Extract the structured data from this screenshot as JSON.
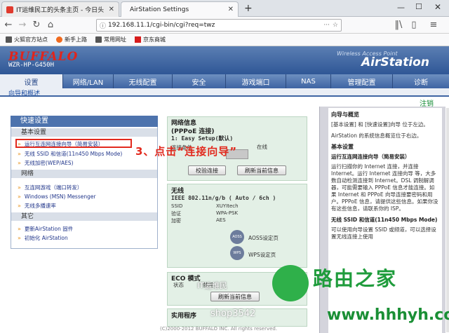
{
  "browser": {
    "tabs": [
      {
        "title": "IT运维民工的头条主页 - 今日头"
      },
      {
        "title": "AirStation Settings"
      }
    ],
    "url": "192.168.11.1/cgi-bin/cgi?req=twz",
    "bookmarks": [
      "火狐官方站点",
      "新手上路",
      "常用网址",
      "京东商城"
    ]
  },
  "header": {
    "logo": "BUFFALO",
    "model": "WZR-HP-G450H",
    "tagline": "Wireless Access Point",
    "product": "AirStation"
  },
  "nav": {
    "items": [
      "设置",
      "网络/LAN",
      "无线配置",
      "安全",
      "游戏端口",
      "NAS",
      "管理配置",
      "诊断"
    ],
    "sub": "向导和概述",
    "logout": "注销"
  },
  "quick": {
    "title": "快速设置",
    "basic_label": "基本设置",
    "basic_items": [
      "运行互连网连接向导（简易安装）",
      "无线 SSID 和信道(11n450 Mbps Mode)",
      "无线加密(WEP/AES)"
    ],
    "net_label": "网络",
    "net_items": [
      "互连网游戏（端口转发）",
      "Windows (MSN) Messenger",
      "无线多播速率"
    ],
    "other_label": "其它",
    "other_items": [
      "更新AirStation 固件",
      "初始化 AirStation"
    ]
  },
  "annotation": "3、点击“连接向导”",
  "netinfo": {
    "title": "网络信息",
    "sub": "(PPPoE 连接)",
    "line": "1: Easy  Setup(默认)",
    "conn_label": "连接条件",
    "conn_value": "在线",
    "btn_connect": "校验连接",
    "btn_refresh": "刷新当前信息"
  },
  "wireless": {
    "title": "无线",
    "mode": "IEEE 802.11n/g/b ( Auto / 6ch )",
    "rows": [
      {
        "k": "SSID",
        "v": "XUYItech"
      },
      {
        "k": "验证",
        "v": "WPA-PSK"
      },
      {
        "k": "加密",
        "v": "AES"
      }
    ],
    "aoss_label": "AOSS设定页",
    "wps_label": "WPS设定页",
    "aoss_icon": "AOSS",
    "wps_icon": "WPS"
  },
  "eco": {
    "title": "ECO 模式",
    "status_label": "状态",
    "status_value": "禁用",
    "btn_refresh": "刷新当前信息"
  },
  "util": {
    "title": "实用程序"
  },
  "help": {
    "title": "向导与概览",
    "p1": "[基本设置] 和 [快速设置]向导 位于左边。",
    "p2": "AirStation 的系统信息概览位于右边。",
    "sub": "基本设置",
    "p3": "运行互连网连接向导（简易安装）",
    "p4": "运行扫描你的 Internet 连接，并连接 Internet。运行 Internet 连接向导 等，大多数自动检测连接到 Internet。DSL 调制解调器，可能需要输入 PPPoE 信息才能连接。如果 Internet 和 PPPoE 向导连接要密码和用户。PPPoE 信息，请提供这些信息。如果你没有这些信息，请联系你的 ISP。",
    "p5": "无线 SSID 和信道(11n450 Mbps Mode)",
    "p6": "可以使用向导设置 SSID 或频道，可以选择设置无线连接上使用"
  },
  "watermark": {
    "brand": "路由之家",
    "url": "www.hhhyh.com",
    "shop": "shop3542",
    "small": "IT运维民"
  },
  "footer": "(C)2000-2012 BUFFALO INC. All rights reserved."
}
